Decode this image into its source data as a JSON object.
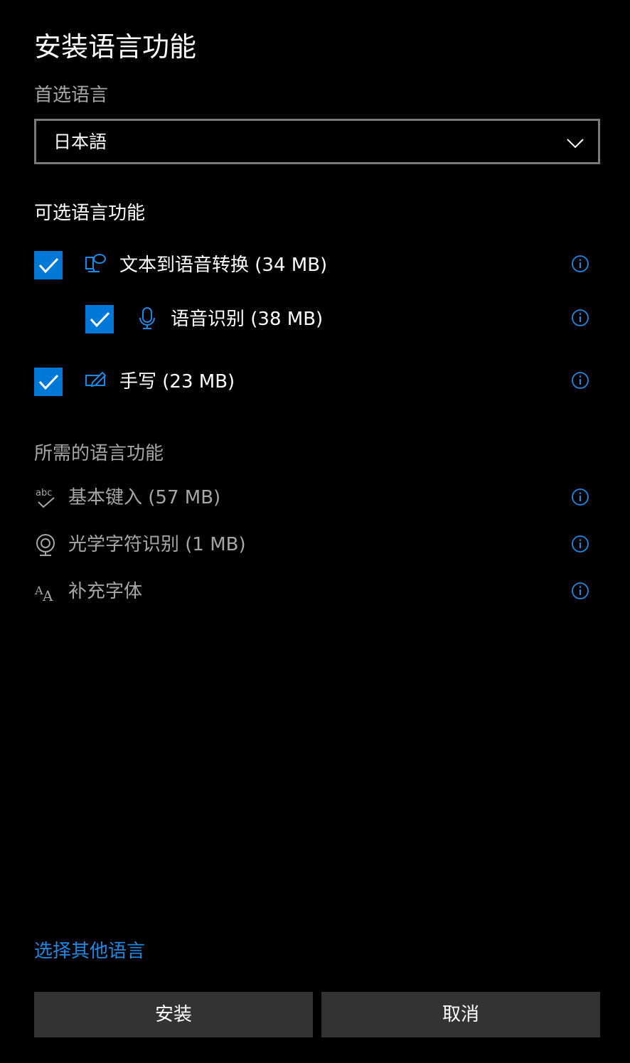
{
  "title": "安装语言功能",
  "preferred_language": {
    "label": "首选语言",
    "selected": "日本語"
  },
  "optional_section": {
    "label": "可选语言功能",
    "items": [
      {
        "label": "文本到语音转换 (34 MB)",
        "checked": true,
        "icon": "text-to-speech-icon"
      },
      {
        "label": "语音识别 (38 MB)",
        "checked": true,
        "icon": "microphone-icon"
      },
      {
        "label": "手写 (23 MB)",
        "checked": true,
        "icon": "handwriting-pen-icon"
      }
    ]
  },
  "required_section": {
    "label": "所需的语言功能",
    "items": [
      {
        "label": "基本键入 (57 MB)",
        "icon": "abc-check-icon"
      },
      {
        "label": "光学字符识别 (1 MB)",
        "icon": "webcam-icon"
      },
      {
        "label": "补充字体",
        "icon": "font-aa-icon"
      }
    ]
  },
  "other_language_link": "选择其他语言",
  "buttons": {
    "install": "安装",
    "cancel": "取消"
  },
  "colors": {
    "accent": "#0078d7",
    "link": "#1b8ae6",
    "muted_text": "#a6a6a6",
    "button_bg": "#333333",
    "background": "#000000"
  }
}
